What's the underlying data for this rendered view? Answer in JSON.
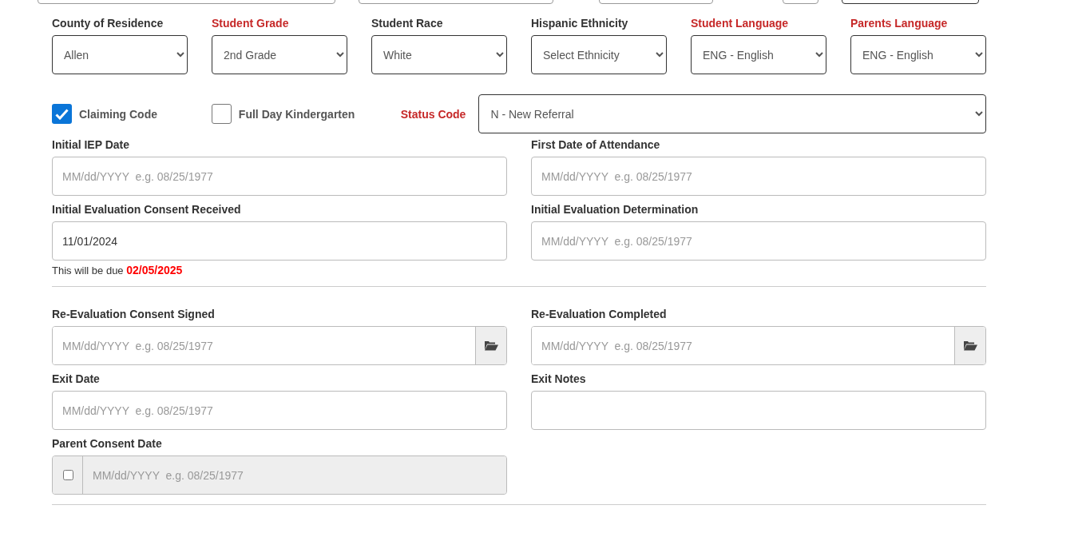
{
  "selects": [
    {
      "label": "County of Residence",
      "required": false,
      "value": "Allen"
    },
    {
      "label": "Student Grade",
      "required": true,
      "value": "2nd Grade"
    },
    {
      "label": "Student Race",
      "required": false,
      "value": "White"
    },
    {
      "label": "Hispanic Ethnicity",
      "required": false,
      "value": "Select Ethnicity"
    },
    {
      "label": "Student Language",
      "required": true,
      "value": "ENG - English"
    },
    {
      "label": "Parents Language",
      "required": true,
      "value": "ENG - English"
    }
  ],
  "checkboxes": [
    {
      "label": "Claiming Code",
      "checked": true
    },
    {
      "label": "Full Day Kindergarten",
      "checked": false
    }
  ],
  "status_code": {
    "label": "Status Code",
    "required": true,
    "value": "N - New Referral"
  },
  "section_1": [
    {
      "label": "Initial IEP Date",
      "kind": "date",
      "placeholder": "MM/dd/YYYY  e.g. 08/25/1977"
    },
    {
      "label": "First Date of Attendance",
      "kind": "date",
      "placeholder": "MM/dd/YYYY  e.g. 08/25/1977"
    },
    {
      "label": "Initial Evaluation Consent Received",
      "kind": "date",
      "value": "11/01/2024",
      "note": "This will be due **02/05/2025**"
    },
    {
      "label": "Initial Evaluation Determination",
      "kind": "date",
      "placeholder": "MM/dd/YYYY  e.g. 08/25/1977"
    }
  ],
  "section_2": [
    {
      "label": "Re-Evaluation Consent Signed",
      "kind": "picker",
      "placeholder": "MM/dd/YYYY  e.g. 08/25/1977"
    },
    {
      "label": "Re-Evaluation Completed",
      "kind": "picker",
      "placeholder": "MM/dd/YYYY  e.g. 08/25/1977"
    },
    {
      "label": "Exit Date",
      "kind": "date",
      "placeholder": "MM/dd/YYYY  e.g. 08/25/1977"
    },
    {
      "label": "Exit Notes",
      "kind": "date"
    },
    {
      "label": "Parent Consent Date",
      "kind": "consent",
      "checked": false,
      "disabled": true,
      "placeholder": "MM/dd/YYYY  e.g. 08/25/1977"
    }
  ]
}
